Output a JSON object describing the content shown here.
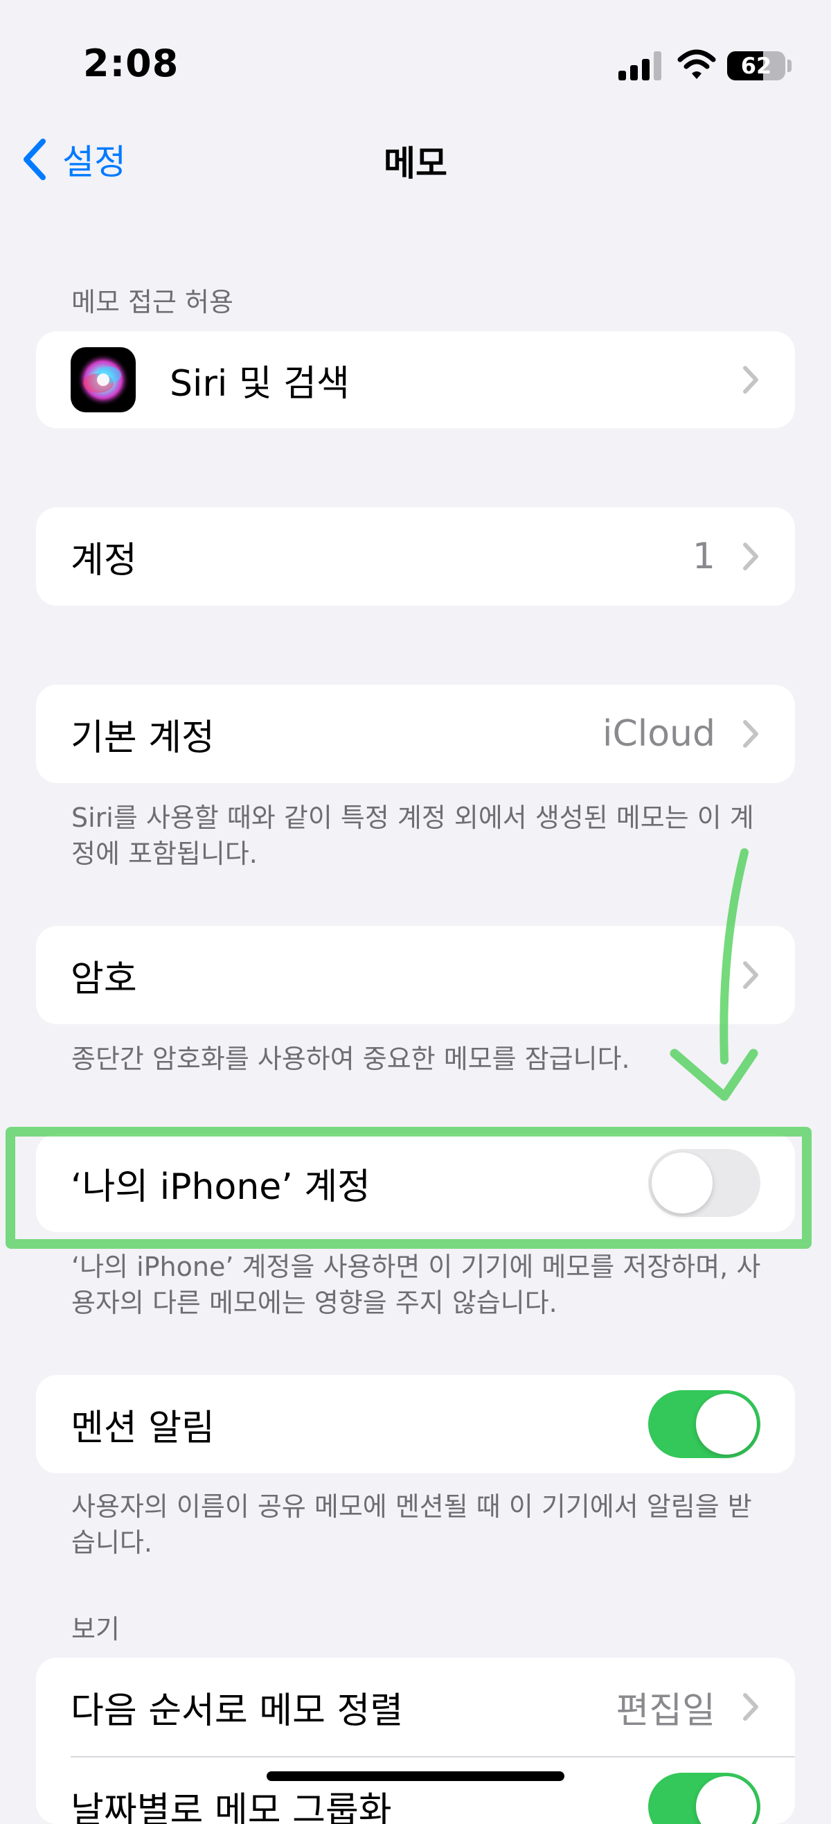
{
  "status_bar": {
    "time": "2:08",
    "battery": "62"
  },
  "nav": {
    "back_label": "설정",
    "title": "메모"
  },
  "sections": {
    "access_header": "메모 접근 허용",
    "siri_label": "Siri 및 검색",
    "accounts_label": "계정",
    "accounts_value": "1",
    "default_account_label": "기본 계정",
    "default_account_value": "iCloud",
    "default_account_footer": "Siri를 사용할 때와 같이 특정 계정 외에서 생성된 메모는 이 계정에 포함됩니다.",
    "password_label": "암호",
    "password_footer": "종단간 암호화를 사용하여 중요한 메모를 잠급니다.",
    "on_my_iphone_label": "‘나의 iPhone’ 계정",
    "on_my_iphone_enabled": false,
    "on_my_iphone_footer": "‘나의 iPhone’ 계정을 사용하면 이 기기에 메모를 저장하며, 사용자의 다른 메모에는 영향을 주지 않습니다.",
    "mentions_label": "멘션 알림",
    "mentions_enabled": true,
    "mentions_footer": "사용자의 이름이 공유 메모에 멘션될 때 이 기기에서 알림을 받습니다.",
    "view_header": "보기",
    "sort_label": "다음 순서로 메모 정렬",
    "sort_value": "편집일",
    "group_by_date_label": "날짜별로 메모 그룹화",
    "group_by_date_enabled": true
  },
  "colors": {
    "accent": "#007aff",
    "toggle_on": "#34c759",
    "annotation": "#46cd50",
    "background": "#f2f2f7"
  },
  "icons": [
    "chevron-left-icon",
    "chevron-right-icon",
    "siri-icon",
    "signal-icon",
    "wifi-icon",
    "battery-icon"
  ]
}
